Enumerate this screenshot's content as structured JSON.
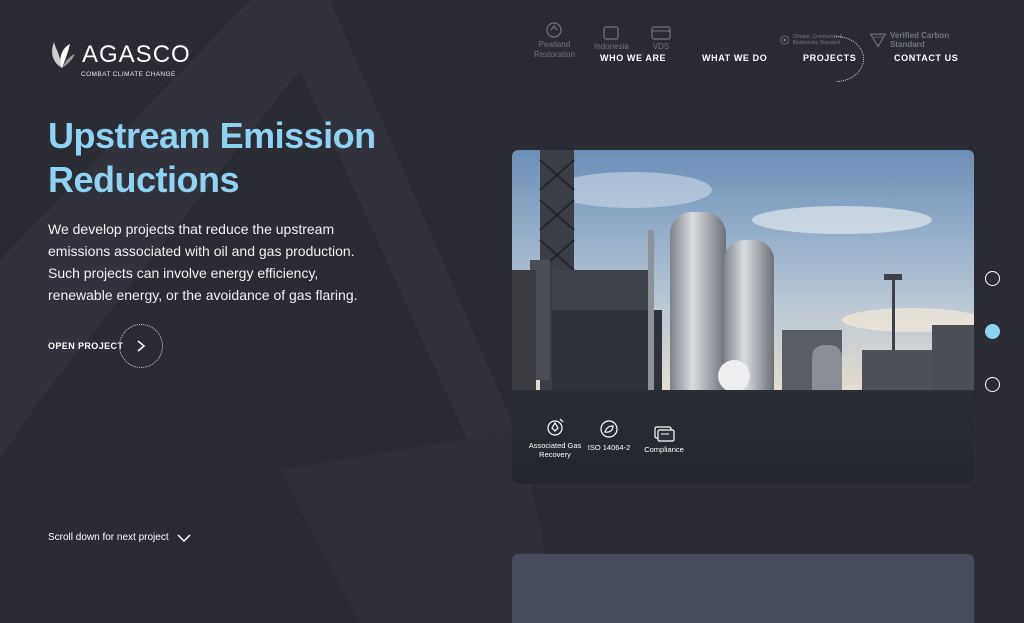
{
  "brand": {
    "name": "AGASCO",
    "tagline": "COMBAT CLIMATE CHANGE"
  },
  "ghost_strip": [
    {
      "label": "Peatland\nRestoration",
      "icon": "peatland-icon"
    },
    {
      "label": "Indonesia",
      "icon": "indonesia-icon"
    },
    {
      "label": "VDS",
      "icon": "vds-icon"
    },
    {
      "label": "Climate, Community & Biodiversity Standard",
      "icon": "ccb-logo"
    },
    {
      "label": "Verified Carbon Standard",
      "icon": "vcs-logo"
    }
  ],
  "nav": {
    "items": [
      "WHO WE ARE",
      "WHAT WE DO",
      "PROJECTS",
      "CONTACT US"
    ],
    "active": "PROJECTS"
  },
  "hero": {
    "title": "Upstream Emission Reductions",
    "description": "We develop projects that reduce the upstream emissions associated with oil and gas production. Such projects can involve energy efficiency, renewable energy, or the avoidance of gas flaring.",
    "cta": "OPEN PROJECT"
  },
  "card": {
    "features": [
      {
        "label": "Associated Gas Recovery",
        "icon": "gas-recovery-icon"
      },
      {
        "label": "ISO 14064-2",
        "icon": "iso-icon"
      },
      {
        "label": "Compliance",
        "icon": "compliance-icon"
      }
    ]
  },
  "pager": {
    "count": 3,
    "active_index": 1
  },
  "scroll": {
    "label": "Scroll down for next project"
  },
  "colors": {
    "background": "#2a2b33",
    "accent": "#8fd3f2",
    "next_card": "#464c5c"
  }
}
